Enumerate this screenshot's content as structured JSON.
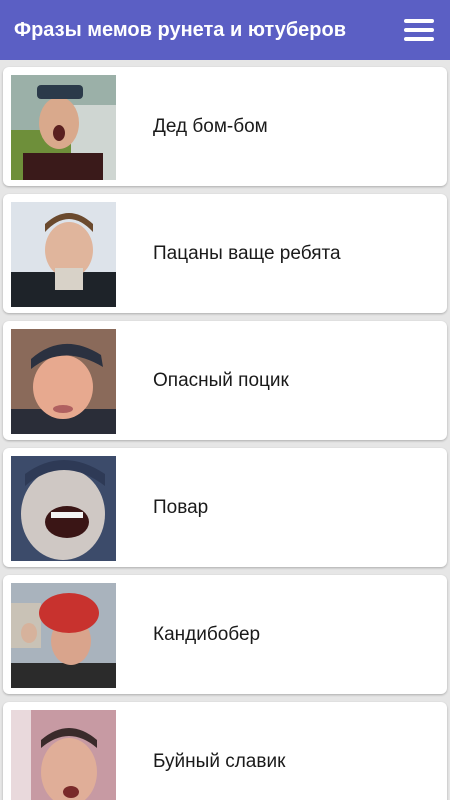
{
  "colors": {
    "accent": "#5b5fc4",
    "card_bg": "#ffffff",
    "list_bg": "#e6e6e6"
  },
  "appbar": {
    "title": "Фразы мемов рунета и ютуберов",
    "menu_icon": "hamburger-menu-icon"
  },
  "items": [
    {
      "label": "Дед бом-бом",
      "thumbnail": "thumbnail-ded-bom-bom"
    },
    {
      "label": "Пацаны ваще ребята",
      "thumbnail": "thumbnail-patsany"
    },
    {
      "label": "Опасный поцик",
      "thumbnail": "thumbnail-opasny-potsik"
    },
    {
      "label": "Повар",
      "thumbnail": "thumbnail-povar"
    },
    {
      "label": "Кандибобер",
      "thumbnail": "thumbnail-kandibober"
    },
    {
      "label": "Буйный славик",
      "thumbnail": "thumbnail-buyny-slavik"
    }
  ]
}
